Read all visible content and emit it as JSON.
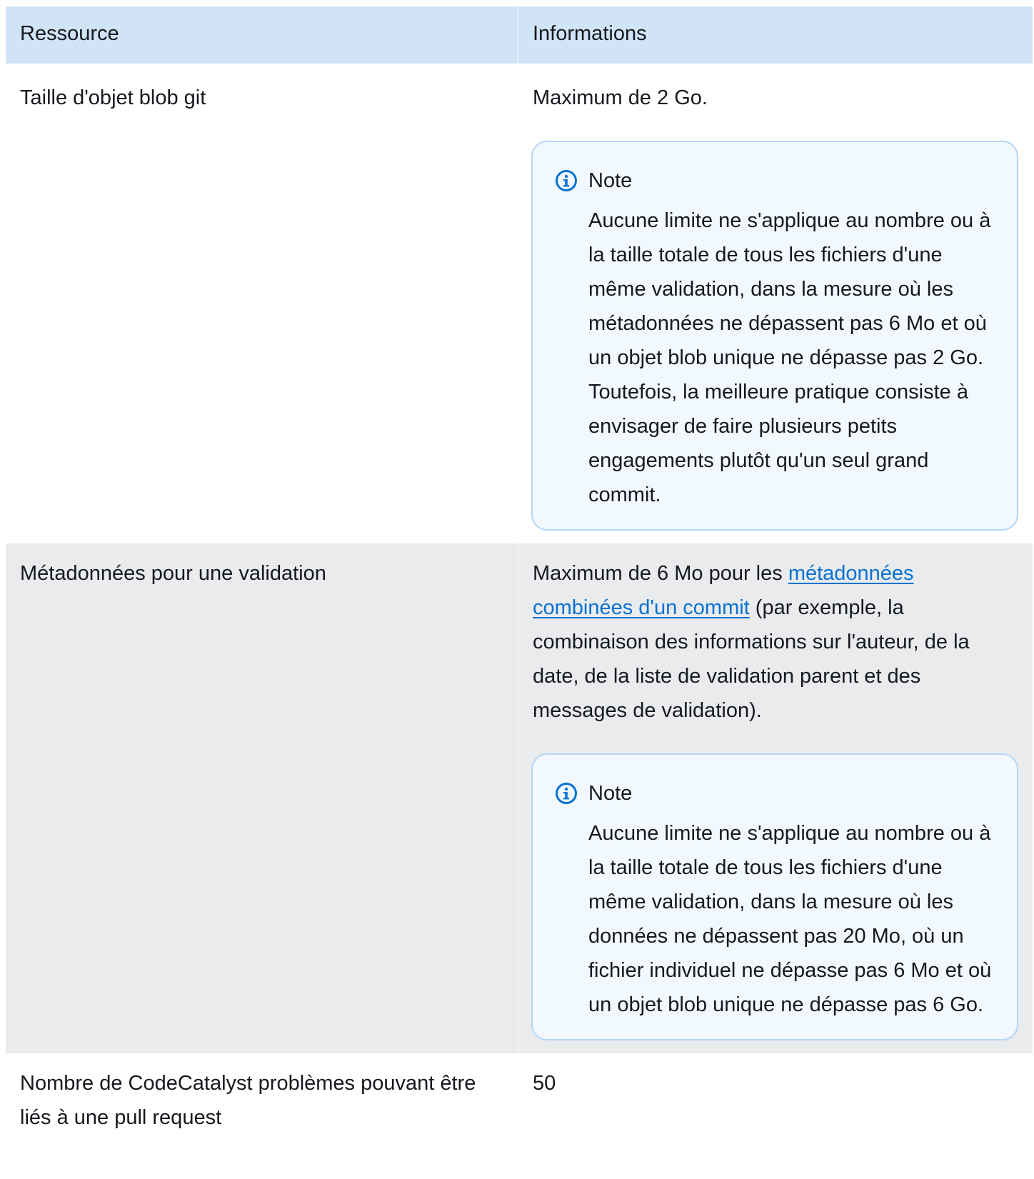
{
  "table": {
    "headers": {
      "resource": "Ressource",
      "info": "Informations"
    },
    "rows": [
      {
        "resource": "Taille d'objet blob git",
        "info": "Maximum de 2 Go.",
        "note": {
          "title": "Note",
          "text": "Aucune limite ne s'applique au nombre ou à la taille totale de tous les fichiers d'une même validation, dans la mesure où les métadonnées ne dépassent pas 6 Mo et où un objet blob unique ne dépasse pas 2 Go. Toutefois, la meilleure pratique consiste à envisager de faire plusieurs petits engagements plutôt qu'un seul grand commit."
        }
      },
      {
        "resource": "Métadonnées pour une validation",
        "info_prefix": "Maximum de 6 Mo pour les ",
        "info_link": "métadonnées combinées d'un commit",
        "info_suffix": " (par exemple, la combinaison des informations sur l'auteur, de la date, de la liste de validation parent et des messages de validation).",
        "note": {
          "title": "Note",
          "text": "Aucune limite ne s'applique au nombre ou à la taille totale de tous les fichiers d'une même validation, dans la mesure où les données ne dépassent pas 20 Mo, où un fichier individuel ne dépasse pas 6 Mo et où un objet blob unique ne dépasse pas 6 Go."
        }
      },
      {
        "resource": "Nombre de CodeCatalyst problèmes pouvant être liés à une pull request",
        "info": "50"
      }
    ]
  },
  "colors": {
    "header_bg": "#d1e4f7",
    "shaded_row_bg": "#e9ebed",
    "note_bg": "#f1f8fe",
    "note_border": "#b5d6f4",
    "info_icon": "#0972d3",
    "link": "#0972d3"
  },
  "icons": {
    "note_icon": "info-circle-icon"
  }
}
